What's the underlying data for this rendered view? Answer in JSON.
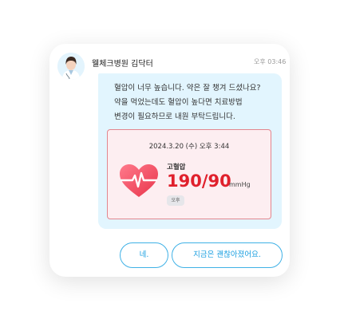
{
  "chat": {
    "sender": "웰체크병원 김닥터",
    "time": "오후 03:46",
    "message_lines": [
      "혈압이 너무 높습니다. 약은 잘 챙겨 드셨나요?",
      "약을 먹었는데도 혈압이 높다면 치료방법",
      "변경이 필요하므로 내원 부탁드립니다."
    ]
  },
  "report": {
    "date": "2024.3.20 (수) 오후 3:44",
    "label": "고혈압",
    "value": "190/90",
    "unit": "mmHg",
    "badge": "오후",
    "icon": "heart-pulse-icon",
    "accent": "#e0202c"
  },
  "actions": {
    "yes": "네.",
    "fine_now": "지금은 괜찮아졌어요."
  },
  "colors": {
    "bubble": "#e2f5fe",
    "button_border": "#3fb1e6",
    "report_border": "#e3868e"
  }
}
